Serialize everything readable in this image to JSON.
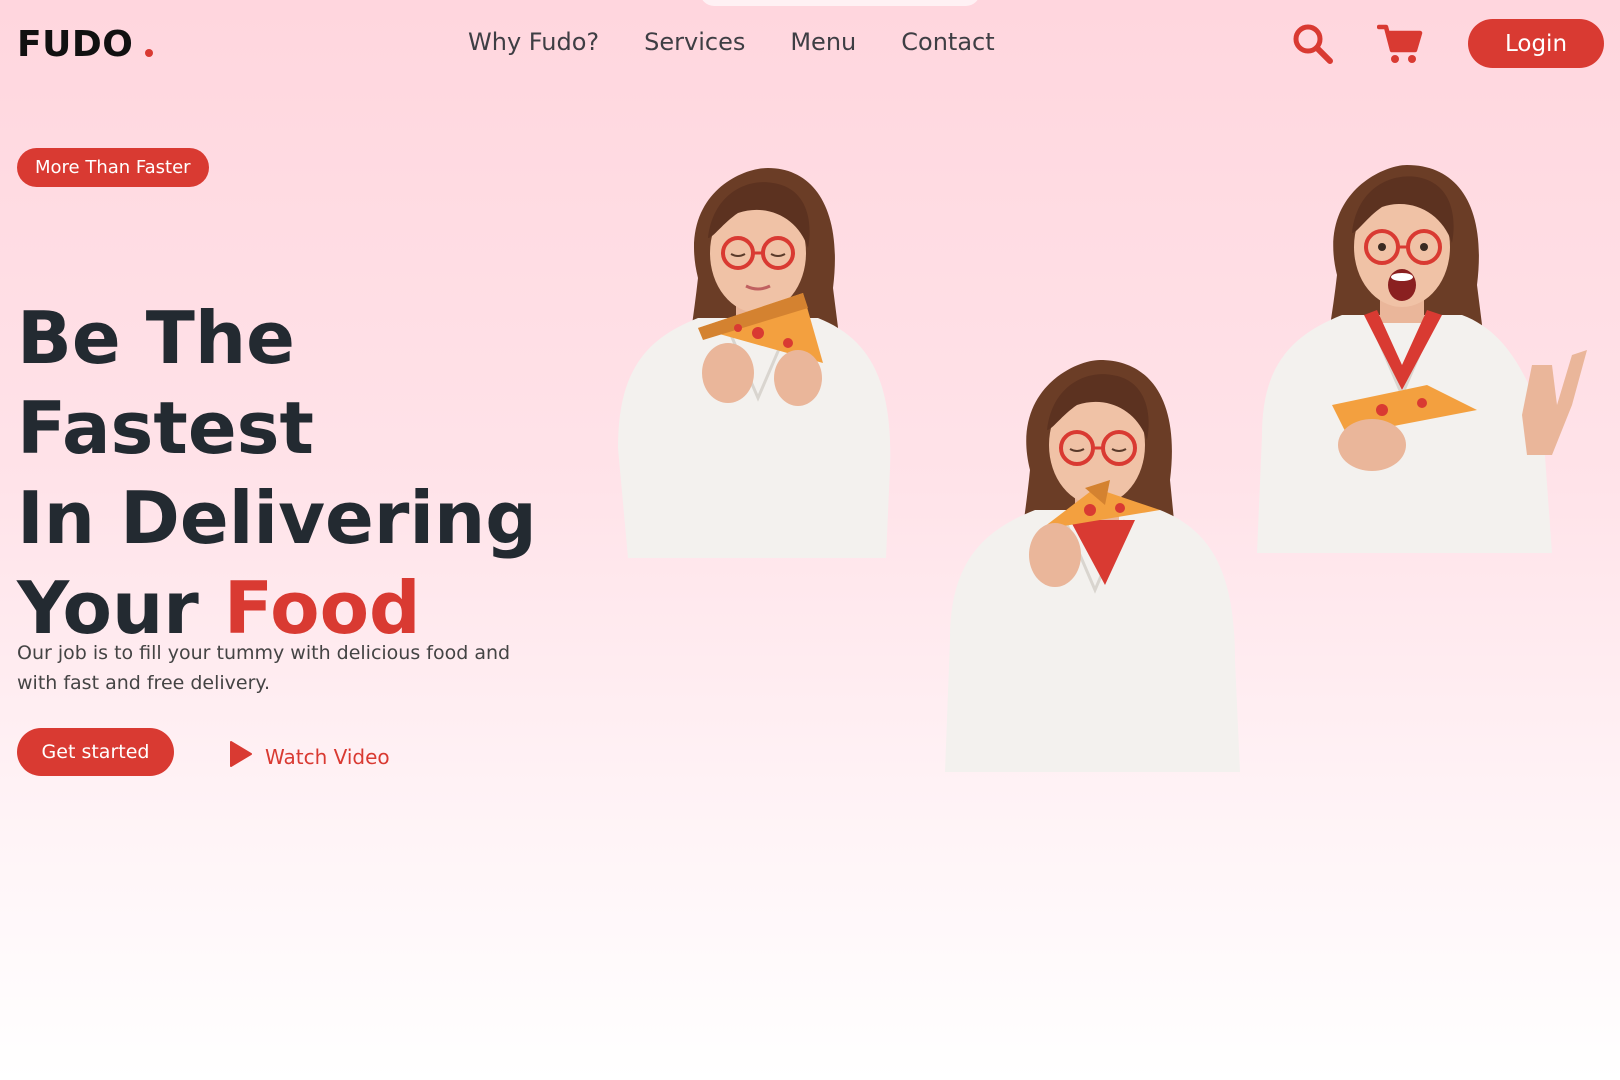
{
  "brand": {
    "name": "FUDO",
    "accent_color": "#d93a32"
  },
  "nav": {
    "links": [
      {
        "label": "Why Fudo?"
      },
      {
        "label": "Services"
      },
      {
        "label": "Menu"
      },
      {
        "label": "Contact"
      }
    ],
    "search_icon": "search-icon",
    "cart_icon": "cart-icon",
    "login_label": "Login"
  },
  "hero": {
    "badge": "More Than Faster",
    "headline_line1": "Be The Fastest",
    "headline_line2": "In Delivering",
    "headline_line3_plain": "Your",
    "headline_line3_accent": "Food",
    "description": "Our job is to fill your tummy with delicious food and with fast and free delivery.",
    "cta_label": "Get started",
    "watch_label": "Watch Video",
    "watch_icon": "play-icon"
  },
  "images": [
    {
      "name": "woman-eating-pizza-eyes-closed"
    },
    {
      "name": "woman-biting-pizza"
    },
    {
      "name": "woman-excited-thumbs-up-pizza"
    }
  ]
}
